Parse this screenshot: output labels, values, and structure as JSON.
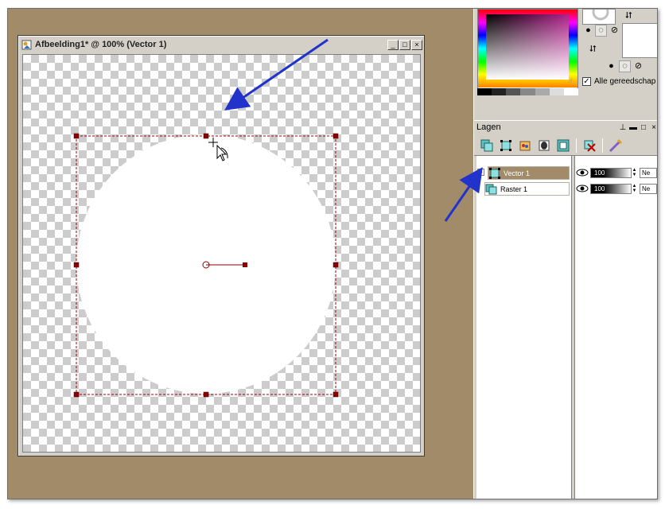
{
  "document": {
    "title": "Afbeelding1* @ 100% (Vector 1)",
    "window_buttons": {
      "minimize": "_",
      "maximize": "□",
      "close": "×"
    }
  },
  "materials": {
    "all_tools_label": "Alle gereedschap",
    "all_tools_checked": "✓"
  },
  "layers": {
    "title": "Lagen",
    "items": [
      {
        "name": "Vector 1",
        "expand": "+",
        "opacity": "100",
        "blend": "Ne",
        "active": true
      },
      {
        "name": "Raster 1",
        "expand": "",
        "opacity": "100",
        "blend": "Ne",
        "active": false
      }
    ]
  },
  "colors": {
    "workspace": "#a18b68",
    "active_layer": "#a18b68",
    "selection": "#a00000",
    "annotation_arrow": "#2233cc"
  },
  "icons": {
    "doc": "psp-document-icon",
    "pin": "pin-icon",
    "close": "close-icon",
    "arrow": "annotation-arrow"
  }
}
